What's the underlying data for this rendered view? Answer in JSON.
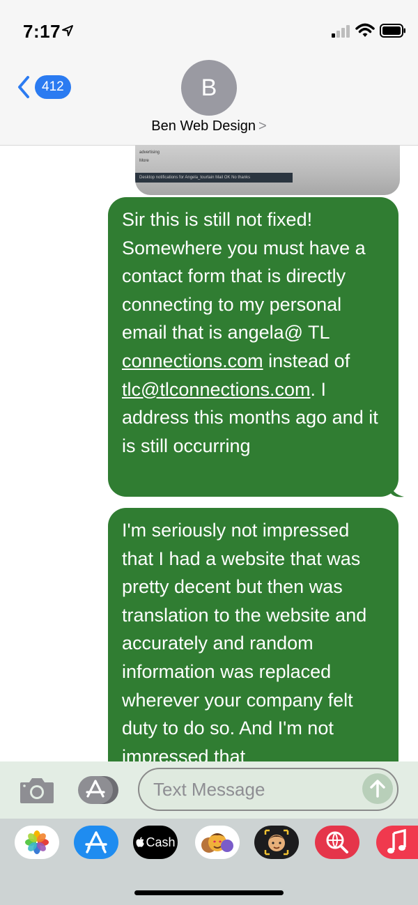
{
  "status_bar": {
    "time": "7:17"
  },
  "header": {
    "back_badge": "412",
    "avatar_initial": "B",
    "contact_name": "Ben Web Design",
    "contact_chevron": ">"
  },
  "photo_preview": {
    "line1": "advertising",
    "line2": "More",
    "bar_text": "Desktop notifications for Angela_tourtain Mail   OK   No thanks"
  },
  "messages": [
    {
      "part1": "Sir this is still not fixed! Somewhere you must have a contact form that is directly connecting to my personal email that is angela@ TL ",
      "link1": "connections.com",
      "part2": " instead of ",
      "link2": "tlc@tlconnections.com",
      "part3": ". I address this months ago and it is still occurring"
    },
    {
      "text": "I'm seriously not impressed that I had a website that was pretty decent but then was translation to the website and accurately and random information was replaced wherever your company felt duty to do so. And I'm not impressed that"
    }
  ],
  "composer": {
    "placeholder": "Text Message"
  },
  "app_drawer": {
    "cash_label": "Cash"
  },
  "colors": {
    "bubble": "#307d32",
    "badge": "#2b7bf1",
    "composer_bg": "#e3ede4",
    "drawer_bg": "#cdd3d3"
  }
}
